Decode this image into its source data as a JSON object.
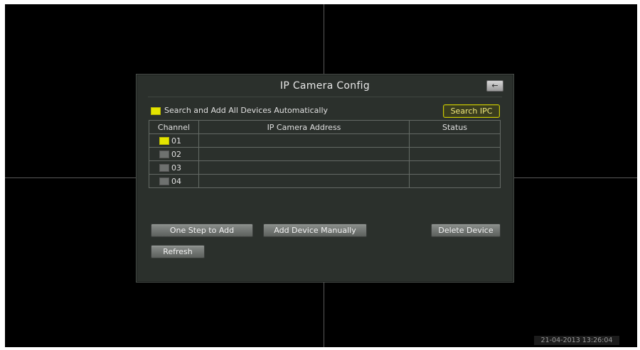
{
  "dialog": {
    "title": "IP Camera Config",
    "back_icon": "←",
    "auto_search_label": "Search and Add All Devices Automatically",
    "auto_search_checked": true,
    "search_button": "Search IPC"
  },
  "table": {
    "headers": [
      "Channel",
      "IP Camera Address",
      "Status"
    ],
    "rows": [
      {
        "channel": "01",
        "checked": true,
        "address": "",
        "status": ""
      },
      {
        "channel": "02",
        "checked": false,
        "address": "",
        "status": ""
      },
      {
        "channel": "03",
        "checked": false,
        "address": "",
        "status": ""
      },
      {
        "channel": "04",
        "checked": false,
        "address": "",
        "status": ""
      }
    ]
  },
  "buttons": {
    "one_step": "One Step to Add",
    "add_manual": "Add Device Manually",
    "delete": "Delete Device",
    "refresh": "Refresh"
  },
  "status_bar": {
    "timestamp": "21-04-2013 13:26:04"
  },
  "colors": {
    "accent_yellow": "#e4e400",
    "dialog_bg": "#2b302c"
  }
}
